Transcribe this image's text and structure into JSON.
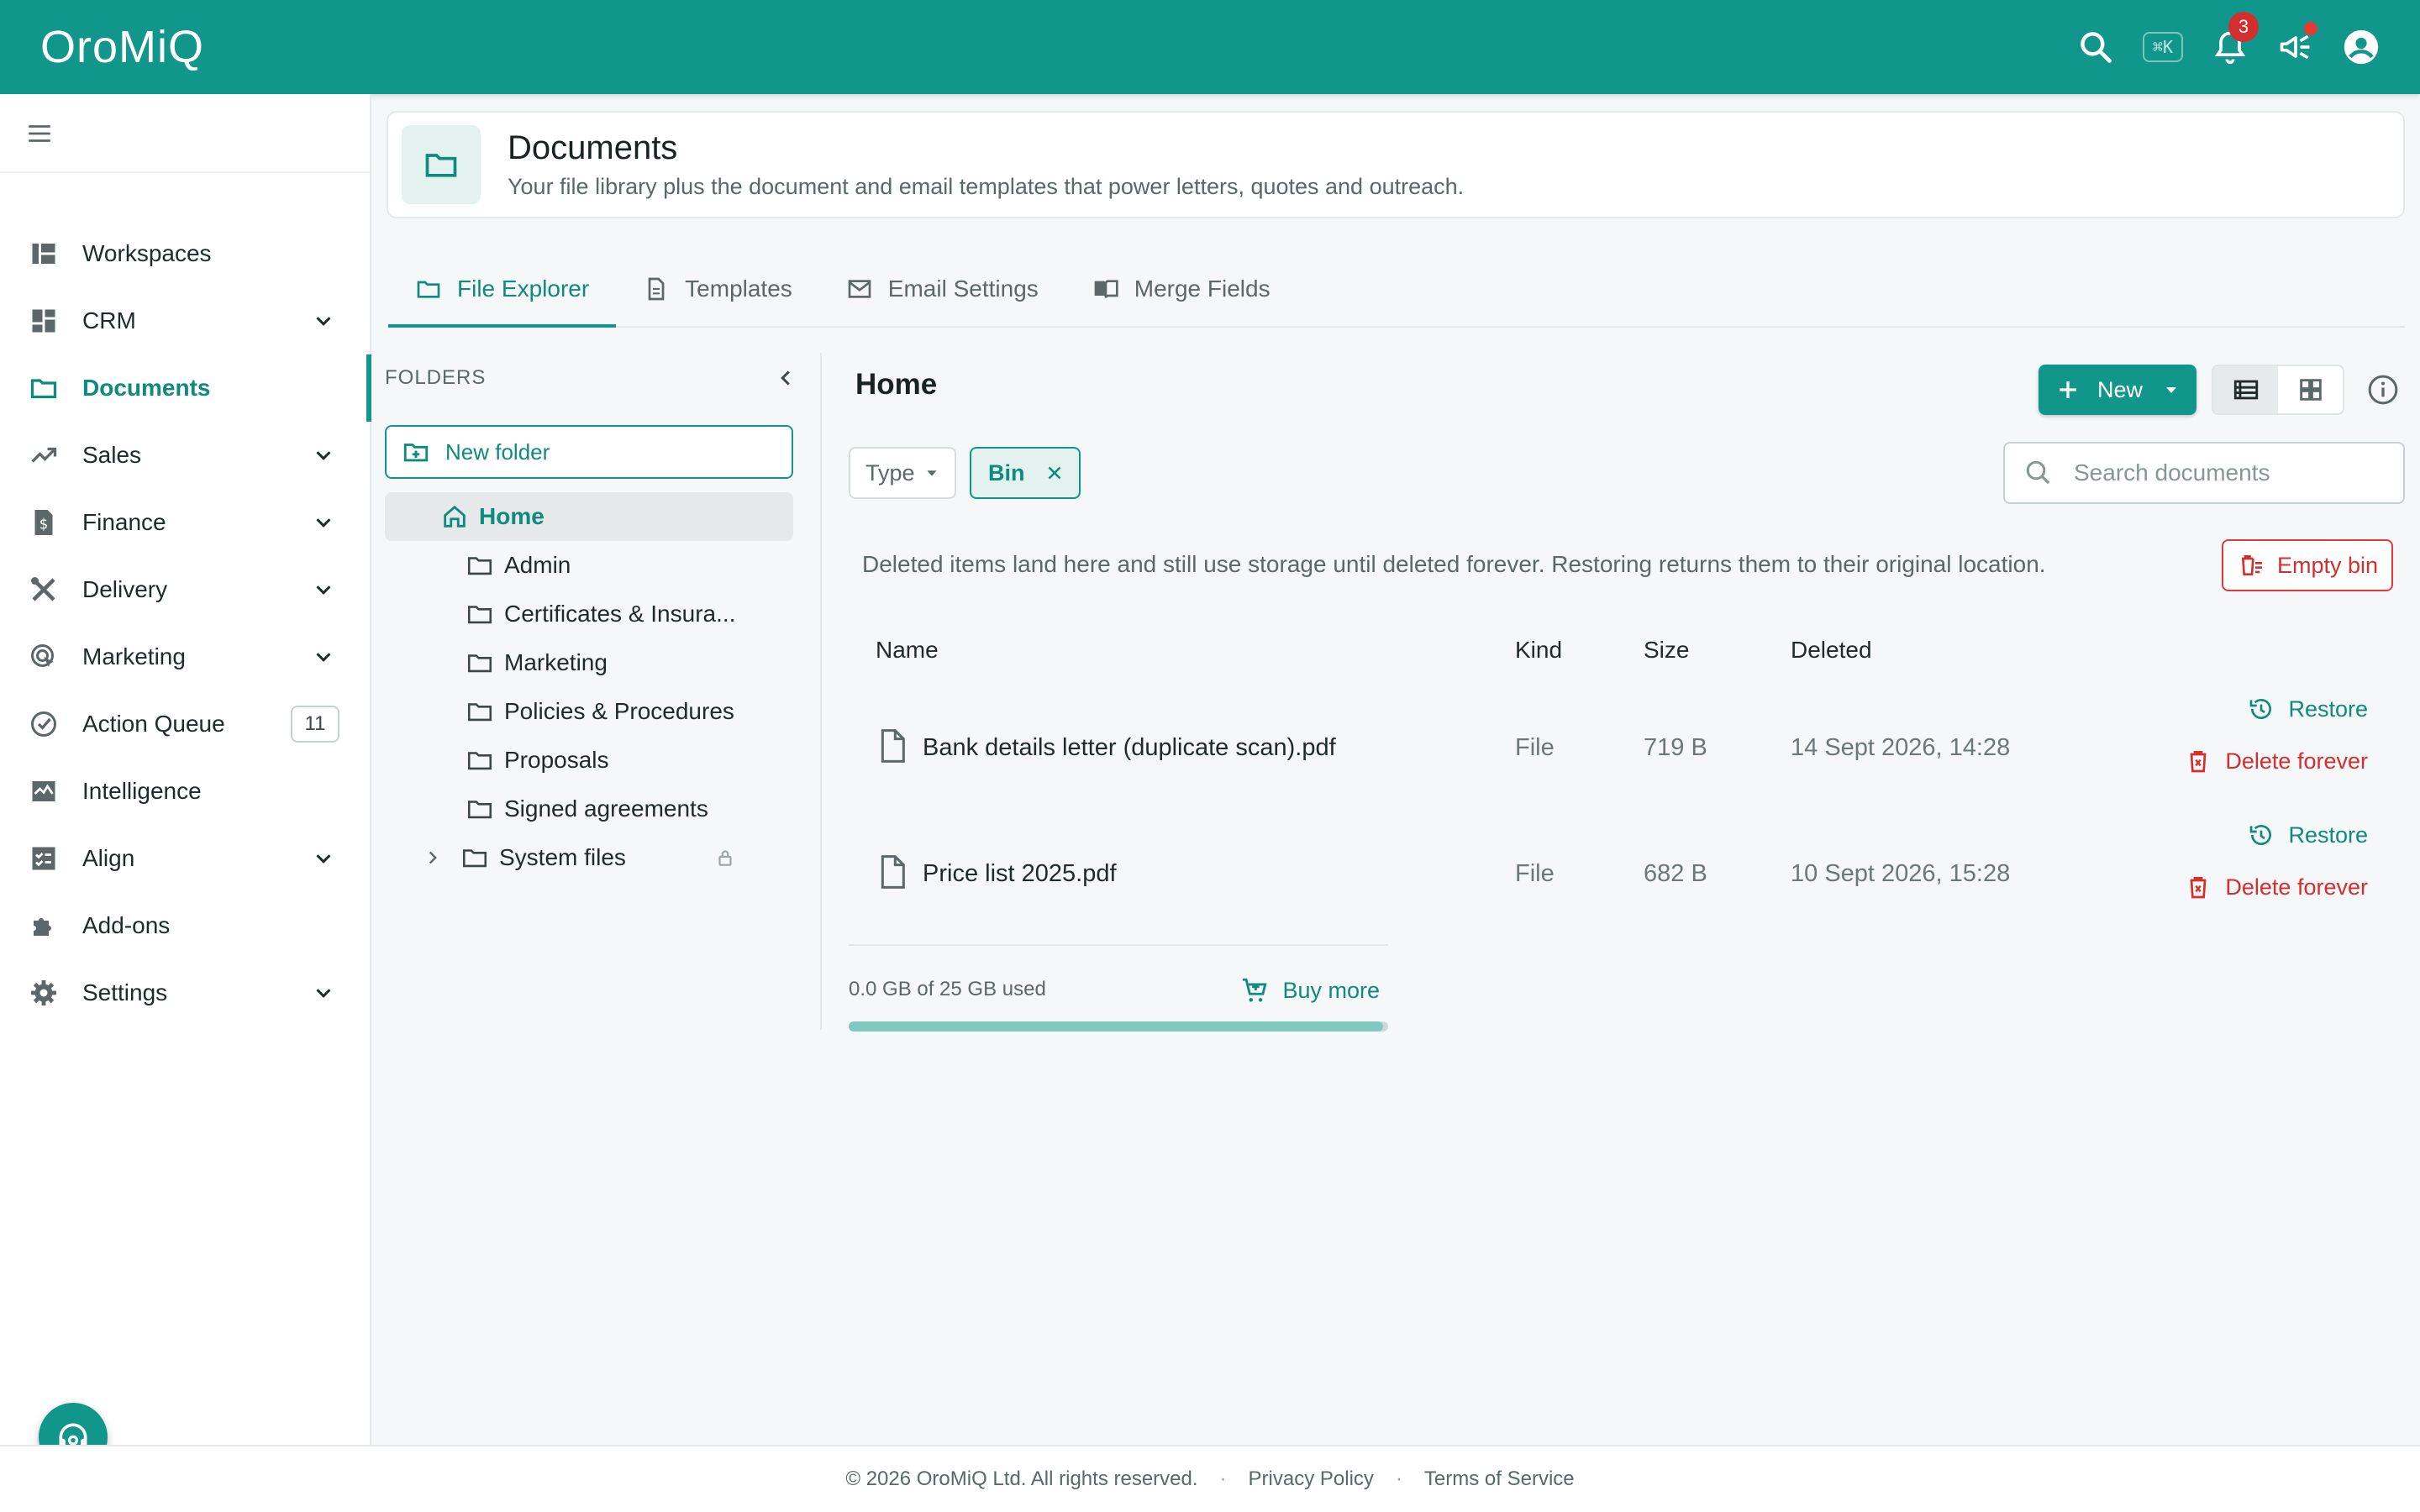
{
  "app": {
    "logo": "OroMiQ",
    "shortcut": "⌘K",
    "notifications_count": "3"
  },
  "sidebar": {
    "items": [
      {
        "label": "Workspaces",
        "icon": "workspaces-icon",
        "has_chevron": false
      },
      {
        "label": "CRM",
        "icon": "crm-dashboard-icon",
        "has_chevron": true
      },
      {
        "label": "Documents",
        "icon": "folder-icon",
        "has_chevron": false,
        "active": true
      },
      {
        "label": "Sales",
        "icon": "trending-up-icon",
        "has_chevron": true
      },
      {
        "label": "Finance",
        "icon": "invoice-icon",
        "has_chevron": true
      },
      {
        "label": "Delivery",
        "icon": "tools-icon",
        "has_chevron": true
      },
      {
        "label": "Marketing",
        "icon": "target-cursor-icon",
        "has_chevron": true
      },
      {
        "label": "Action Queue",
        "icon": "check-circle-icon",
        "has_chevron": false,
        "count": "11"
      },
      {
        "label": "Intelligence",
        "icon": "analytics-icon",
        "has_chevron": false
      },
      {
        "label": "Align",
        "icon": "checklist-icon",
        "has_chevron": true
      },
      {
        "label": "Add-ons",
        "icon": "puzzle-icon",
        "has_chevron": false
      },
      {
        "label": "Settings",
        "icon": "gear-icon",
        "has_chevron": true
      }
    ]
  },
  "header": {
    "title": "Documents",
    "subtitle": "Your file library plus the document and email templates that power letters, quotes and outreach."
  },
  "tabs": [
    {
      "label": "File Explorer",
      "active": true
    },
    {
      "label": "Templates"
    },
    {
      "label": "Email Settings"
    },
    {
      "label": "Merge Fields"
    }
  ],
  "folders": {
    "heading": "FOLDERS",
    "new_folder_label": "New folder",
    "home": "Home",
    "children": [
      "Admin",
      "Certificates & Insura...",
      "Marketing",
      "Policies & Procedures",
      "Proposals",
      "Signed agreements"
    ],
    "system": "System files"
  },
  "main": {
    "title": "Home",
    "new_label": "New",
    "filter_type": "Type",
    "filter_bin": "Bin",
    "search_placeholder": "Search documents",
    "bin_note": "Deleted items land here and still use storage until deleted forever. Restoring returns them to their original location.",
    "empty_bin_label": "Empty bin",
    "columns": {
      "name": "Name",
      "kind": "Kind",
      "size": "Size",
      "deleted": "Deleted"
    },
    "rows": [
      {
        "name": "Bank details letter (duplicate scan).pdf",
        "kind": "File",
        "size": "719 B",
        "deleted": "14 Sept 2026, 14:28"
      },
      {
        "name": "Price list 2025.pdf",
        "kind": "File",
        "size": "682 B",
        "deleted": "10 Sept 2026, 15:28"
      }
    ],
    "restore_label": "Restore",
    "delete_label": "Delete forever"
  },
  "storage": {
    "used_text": "0.0 GB of 25 GB used",
    "buy_more_label": "Buy more",
    "used_fraction": 0.99
  },
  "footer": {
    "copyright": "© 2026 OroMiQ Ltd. All rights reserved.",
    "privacy": "Privacy Policy",
    "terms": "Terms of Service"
  },
  "colors": {
    "brand": "#10968a",
    "danger": "#d32f2f"
  }
}
